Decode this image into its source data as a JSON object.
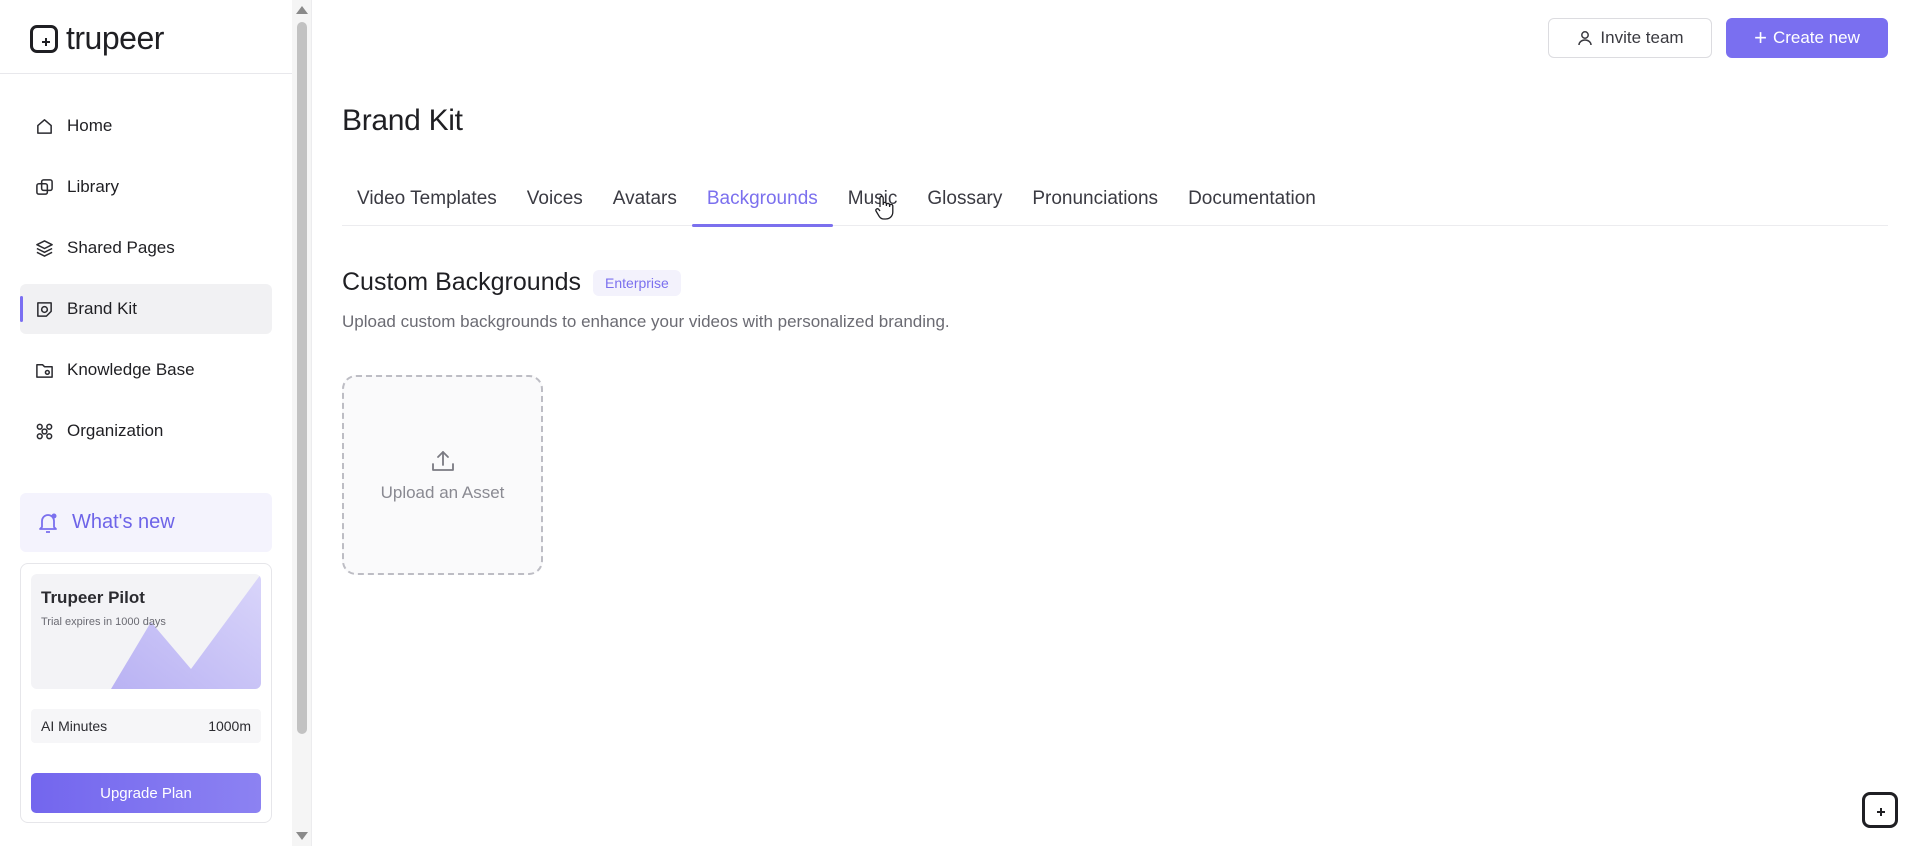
{
  "app": {
    "logo_text": "trupeer"
  },
  "sidebar": {
    "items": [
      {
        "label": "Home",
        "icon": "home-icon"
      },
      {
        "label": "Library",
        "icon": "library-icon"
      },
      {
        "label": "Shared Pages",
        "icon": "layers-icon"
      },
      {
        "label": "Brand Kit",
        "icon": "brand-kit-icon",
        "active": true
      },
      {
        "label": "Knowledge Base",
        "icon": "folder-icon"
      },
      {
        "label": "Organization",
        "icon": "organization-icon"
      }
    ],
    "whats_new": "What's new",
    "plan_card": {
      "title": "Trupeer Pilot",
      "subtitle": "Trial expires in 1000 days",
      "minutes_label": "AI Minutes",
      "minutes_value": "1000m",
      "upgrade_label": "Upgrade Plan"
    }
  },
  "header": {
    "invite_label": "Invite team",
    "create_label": "Create new"
  },
  "main": {
    "title": "Brand Kit",
    "tabs": [
      {
        "label": "Video Templates"
      },
      {
        "label": "Voices"
      },
      {
        "label": "Avatars"
      },
      {
        "label": "Backgrounds",
        "active": true
      },
      {
        "label": "Music"
      },
      {
        "label": "Glossary"
      },
      {
        "label": "Pronunciations"
      },
      {
        "label": "Documentation"
      }
    ],
    "section": {
      "title": "Custom Backgrounds",
      "badge": "Enterprise",
      "description": "Upload custom backgrounds to enhance your videos with personalized branding."
    },
    "upload": {
      "label": "Upload an Asset"
    }
  },
  "colors": {
    "accent": "#7b70ee",
    "active_bg": "#f1f1f3",
    "text": "#1f1f23"
  }
}
